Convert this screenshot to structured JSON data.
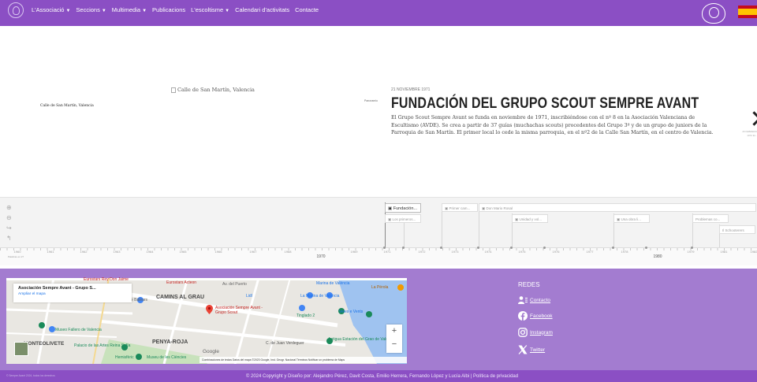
{
  "nav": {
    "items": [
      {
        "label": "L'Associació",
        "caret": true
      },
      {
        "label": "Seccions",
        "caret": true
      },
      {
        "label": "Multimedia",
        "caret": true
      },
      {
        "label": "Publicacions",
        "caret": false
      },
      {
        "label": "L'escoltisme",
        "caret": true
      },
      {
        "label": "Calendari d'activitats",
        "caret": false
      },
      {
        "label": "Contacte",
        "caret": false
      }
    ],
    "flag_colors": [
      "#c60b1e",
      "#ffc400"
    ],
    "accent": "#8b4fc4"
  },
  "slide": {
    "map_label": "Calle de San Martín, Valencia",
    "image_alt": "Calle de San Martín, Valencia",
    "credit": "Panoramio",
    "date": "21 NOVIEMBRE 1971",
    "title": "FUNDACIÓN DEL GRUPO SCOUT SEMPRE AVANT",
    "text": "El Grupo Scout Sempre Avant se funda en noviembre de 1971, inscribiéndose con el nº 8 en la Asociación Valenciana de Escultismo (AVDE). Se crea a partir de 37 guías (muchachas scouts) procedentes del Grupo 3º y de un grupo de juniors de la Parroquia de San Martín. El primer local lo cede la misma parroquia, en el nº2 de la Calle San Martín, en el centro de Valencia.",
    "next_caption": "20 FEBRERO 1972 El..."
  },
  "timenav": {
    "tools": [
      "zoom-in",
      "zoom-out",
      "back",
      "share"
    ],
    "flags": [
      {
        "label": "Fundación...",
        "active": true
      },
      {
        "label": "Los primeros..."
      },
      {
        "label": "Primer cam..."
      },
      {
        "label": "Don Mario Rosal"
      },
      {
        "label": "Unidad y vol..."
      },
      {
        "label": "Una obra li..."
      },
      {
        "label": "Problemas co..."
      },
      {
        "label": "Il Schooterers"
      }
    ],
    "years_minor": [
      "1960",
      "1961",
      "1962",
      "1963",
      "1964",
      "1965",
      "1966",
      "1967",
      "1968",
      "1969",
      "1971",
      "1972",
      "1973",
      "1974",
      "1975",
      "1976",
      "1977",
      "1978",
      "1979",
      "1981",
      "1982"
    ],
    "years_major": [
      "1970",
      "1980"
    ],
    "axis_start_label": "Palabras en 27"
  },
  "map": {
    "place_title": "Asociación Sempre Avant - Grupo S...",
    "expand_link": "Ampliar el mapa",
    "pin_label": "Asociación Sempre Avant - Grupo Scout",
    "labels": [
      "CAMINS AL GRAU",
      "PENYA-ROJA",
      "MONTEOLIVETE",
      "La Marina de València",
      "Museo Fallero de Valencia",
      "Palacio de las Artes Reina Sofía",
      "Tinglado 2",
      "Eurostars Acteon",
      "Hemisfèric",
      "Museu de les Ciències",
      "Lidl",
      "Av. de Balears",
      "Av. del Puerto",
      "Marina de València",
      "La Pérola",
      "Antigua Estación del Grao de València",
      "C. de Juan Verdeguer",
      "Veles e Vents",
      "Eurostars Rey Don Jaime"
    ],
    "logo": "Google",
    "attribution": "Combinaciones de teclas   Datos del mapa ©2023 Google, Inst. Geogr. Nacional   Términos   Notificar un problema de Maps"
  },
  "redes": {
    "title": "REDES",
    "items": [
      {
        "icon": "contact-icon",
        "label": "Contacto"
      },
      {
        "icon": "facebook-icon",
        "label": "Facebook"
      },
      {
        "icon": "instagram-icon",
        "label": "Instagram"
      },
      {
        "icon": "x-twitter-icon",
        "label": "Twitter"
      }
    ]
  },
  "footer": {
    "left_small": "© Sempre Avant 2024, todos los derechos",
    "copyright": "© 2024 Copyright y Diseño por: Alejandro Pérez, Davit Costa, Emilio Herrera, Fernando López y Lucía Albi | Política de privacidad"
  }
}
